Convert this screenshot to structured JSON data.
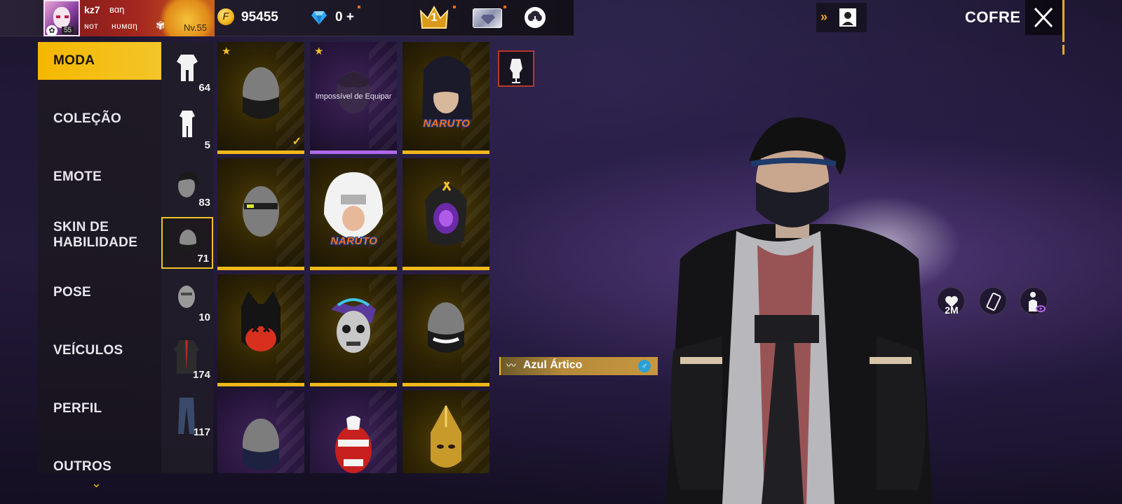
{
  "player": {
    "name": "kz7",
    "tag": "ʙɑη",
    "clan": "ɴoт",
    "clan2": "нυмɑη",
    "avatar_level": "55",
    "level": "Nv.55"
  },
  "currency": {
    "coins": "95455",
    "diamonds": "0",
    "diamond_plus": "+"
  },
  "rank": {
    "value": "1"
  },
  "header": {
    "title": "COFRE"
  },
  "menu": {
    "items": [
      {
        "label": "MODA",
        "active": true
      },
      {
        "label": "COLEÇÃO"
      },
      {
        "label": "EMOTE"
      },
      {
        "label": "SKIN DE HABILIDADE"
      },
      {
        "label": "POSE"
      },
      {
        "label": "VEÍCULOS"
      },
      {
        "label": "PERFIL"
      },
      {
        "label": "OUTROS"
      }
    ]
  },
  "categories": [
    {
      "icon": "full-outfit-icon",
      "count": "64"
    },
    {
      "icon": "jumpsuit-icon",
      "count": "5"
    },
    {
      "icon": "hair-icon",
      "count": "83"
    },
    {
      "icon": "mask-icon",
      "count": "71",
      "active": true
    },
    {
      "icon": "head-mask-icon",
      "count": "10"
    },
    {
      "icon": "top-icon",
      "count": "174"
    },
    {
      "icon": "pants-icon",
      "count": "117"
    }
  ],
  "grid": {
    "unequippable_note": "Impossível de Equipar",
    "naruto_logo": "NARUTO"
  },
  "character": {
    "outfit_name": "Azul Ártico",
    "gender_symbol": "♂"
  },
  "side_buttons": {
    "likes_label": "2M"
  },
  "colors": {
    "accent": "#f5b800",
    "gold_tile": "#2c2204",
    "purple_tile": "#2a1740"
  }
}
